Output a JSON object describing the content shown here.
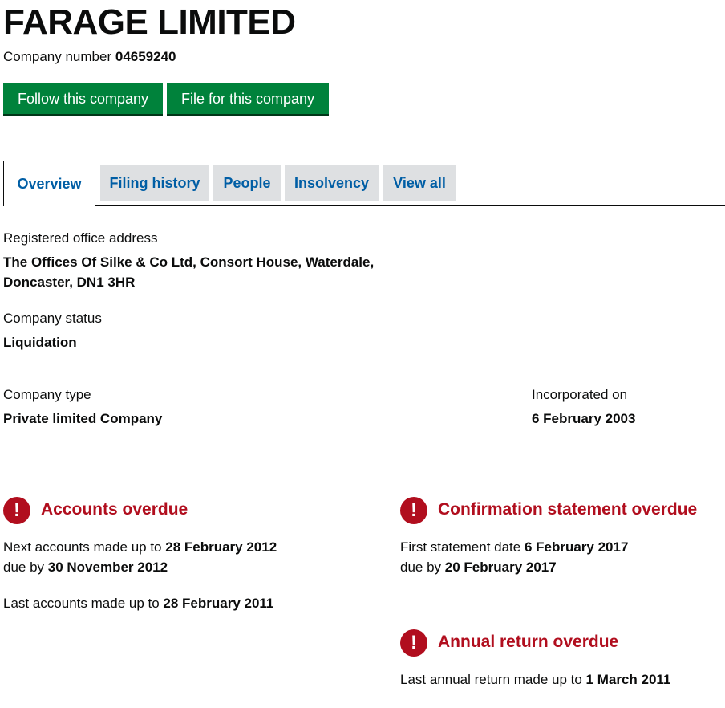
{
  "company": {
    "name": "FARAGE LIMITED",
    "number_label": "Company number",
    "number": "04659240"
  },
  "actions": {
    "follow": "Follow this company",
    "file": "File for this company"
  },
  "tabs": [
    {
      "label": "Overview",
      "active": true
    },
    {
      "label": "Filing history",
      "active": false
    },
    {
      "label": "People",
      "active": false
    },
    {
      "label": "Insolvency",
      "active": false
    },
    {
      "label": "View all",
      "active": false
    }
  ],
  "overview": {
    "address_label": "Registered office address",
    "address_line1": "The Offices Of Silke & Co Ltd, Consort House, Waterdale,",
    "address_line2": "Doncaster, DN1 3HR",
    "status_label": "Company status",
    "status_value": "Liquidation",
    "type_label": "Company type",
    "type_value": "Private limited Company",
    "incorporated_label": "Incorporated on",
    "incorporated_value": "6 February 2003"
  },
  "alerts": {
    "accounts": {
      "icon": "exclamation-icon",
      "title": "Accounts overdue",
      "next_prefix": "Next accounts made up to ",
      "next_date": "28 February 2012",
      "due_prefix": "due by ",
      "due_date": "30 November 2012",
      "last_prefix": "Last accounts made up to ",
      "last_date": "28 February 2011"
    },
    "confirmation": {
      "icon": "exclamation-icon",
      "title": "Confirmation statement overdue",
      "first_prefix": "First statement date ",
      "first_date": "6 February 2017",
      "due_prefix": "due by ",
      "due_date": "20 February 2017"
    },
    "annual_return": {
      "icon": "exclamation-icon",
      "title": "Annual return overdue",
      "last_prefix": "Last annual return made up to ",
      "last_date": "1 March 2011"
    },
    "icon_glyph": "!"
  },
  "colors": {
    "button_green": "#00823b",
    "link_blue": "#005ea5",
    "alert_red": "#b10e1e",
    "tab_grey": "#dee0e2"
  }
}
